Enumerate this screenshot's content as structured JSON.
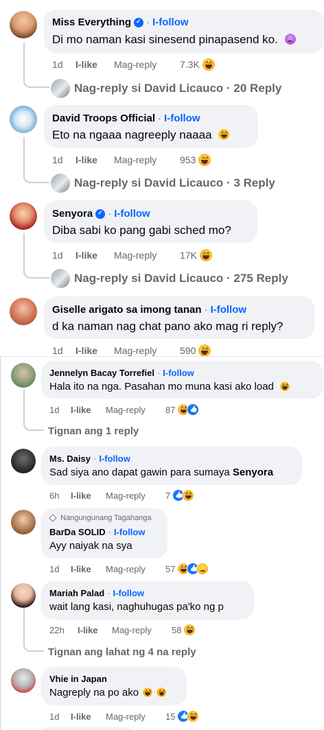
{
  "comments": [
    {
      "author": "Miss Everything",
      "verified": true,
      "follow": "I-follow",
      "text": "Di mo naman kasi sinesend pinapasend ko.",
      "time": "1d",
      "like": "I-like",
      "reply": "Mag-reply",
      "count": "7.3K",
      "reply_summary": "Nag-reply si David Licauco · 20 Reply"
    },
    {
      "author": "David Troops Official",
      "verified": false,
      "follow": "I-follow",
      "text": "Eto na ngaaa nagreeply naaaa",
      "time": "1d",
      "like": "I-like",
      "reply": "Mag-reply",
      "count": "953",
      "reply_summary": "Nag-reply si David Licauco · 3 Reply"
    },
    {
      "author": "Senyora",
      "verified": true,
      "follow": "I-follow",
      "text": "Diba sabi ko pang gabi sched mo?",
      "time": "1d",
      "like": "I-like",
      "reply": "Mag-reply",
      "count": "17K",
      "reply_summary": "Nag-reply si David Licauco · 275 Reply"
    },
    {
      "author": "Giselle arigato sa imong tanan",
      "verified": false,
      "follow": "I-follow",
      "text": "d ka naman nag chat pano ako mag ri reply?",
      "time": "1d",
      "like": "I-like",
      "reply": "Mag-reply",
      "count": "590"
    },
    {
      "author": "Jennelyn Bacay Torrefiel",
      "follow": "I-follow",
      "text": "Hala ito na nga. Pasahan mo muna kasi ako load",
      "time": "1d",
      "like": "I-like",
      "reply": "Mag-reply",
      "count": "87",
      "view_replies": "Tignan ang 1 reply"
    },
    {
      "author": "Ms. Daisy",
      "follow": "I-follow",
      "text": "Sad siya ano dapat gawin para sumaya ",
      "text_bold": "Senyora",
      "time": "6h",
      "like": "I-like",
      "reply": "Mag-reply",
      "count": "7"
    },
    {
      "badge": "Nangungunang Tagahanga",
      "author": "BarDa SOLID",
      "follow": "I-follow",
      "text": "Ayy naiyak na sya",
      "time": "1d",
      "like": "I-like",
      "reply": "Mag-reply",
      "count": "57"
    },
    {
      "author": "Mariah Palad",
      "follow": "I-follow",
      "text": "wait lang kasi, naghuhugas pa'ko ng p",
      "time": "22h",
      "like": "I-like",
      "reply": "Mag-reply",
      "count": "58",
      "view_replies": "Tignan ang lahat ng 4 na reply"
    },
    {
      "author": "Vhie in Japan",
      "text": "Nagreply na po ako",
      "time": "1d",
      "like": "I-like",
      "reply": "Mag-reply",
      "count": "15"
    }
  ],
  "colors": {
    "accent": "#0866ff",
    "bubble": "#f0f2f5",
    "meta": "#65676b"
  }
}
